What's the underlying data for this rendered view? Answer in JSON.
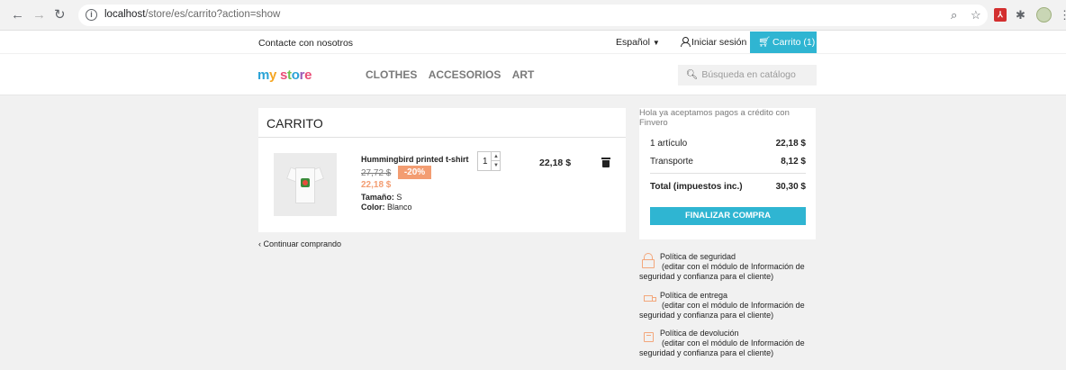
{
  "browser": {
    "url_host": "localhost",
    "url_path": "/store/es/carrito?action=show"
  },
  "header": {
    "contact": "Contacte con nosotros",
    "language": "Español",
    "login": "Iniciar sesión",
    "cart_button": "Carrito (1)",
    "logo": {
      "m": "m",
      "y": "y",
      "space": " ",
      "s": "s",
      "t": "t",
      "o": "o",
      "r": "r",
      "e": "e"
    },
    "menu": [
      "CLOTHES",
      "ACCESORIOS",
      "ART"
    ],
    "search_placeholder": "Búsqueda en catálogo"
  },
  "cart": {
    "title": "CARRITO",
    "item": {
      "name": "Hummingbird printed t-shirt",
      "old_price": "27,72 $",
      "discount": "-20%",
      "price": "22,18 $",
      "size_label": "Tamaño:",
      "size_value": "S",
      "color_label": "Color:",
      "color_value": "Blanco",
      "quantity": "1",
      "line_total": "22,18 $"
    },
    "continue_label": "Continuar comprando"
  },
  "summary": {
    "finvero_note": "Hola ya aceptamos pagos a crédito con Finvero",
    "items_label": "1 artículo",
    "items_value": "22,18 $",
    "shipping_label": "Transporte",
    "shipping_value": "8,12 $",
    "total_label": "Total (impuestos inc.)",
    "total_value": "30,30 $",
    "checkout_label": "FINALIZAR COMPRA"
  },
  "reassurance": [
    {
      "title": "Política de seguridad",
      "line1": "(editar con el módulo de Información de",
      "line2": "seguridad y confianza para el cliente)",
      "icon": "lock-icon"
    },
    {
      "title": "Política de entrega",
      "line1": "(editar con el módulo de Información de",
      "line2": "seguridad y confianza para el cliente)",
      "icon": "truck-icon"
    },
    {
      "title": "Política de devolución",
      "line1": "(editar con el módulo de Información de",
      "line2": "seguridad y confianza para el cliente)",
      "icon": "return-icon"
    }
  ],
  "colors": {
    "accent": "#2fb5d2",
    "discount": "#f39d72"
  }
}
